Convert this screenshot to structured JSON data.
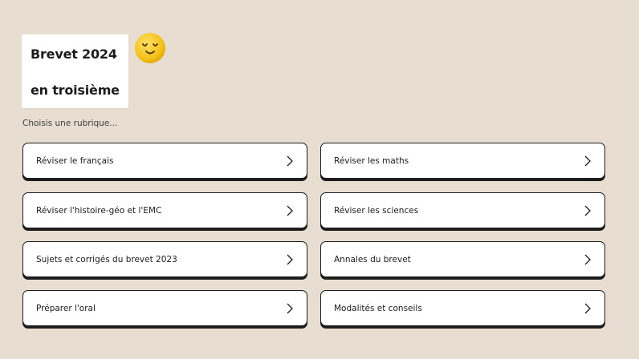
{
  "header": {
    "title_line1": "Brevet 2024",
    "title_line2": "en troisième",
    "subtitle": "Choisis une rubrique..."
  },
  "emoji": {
    "icon": "smiling-face-icon",
    "color": "#f5c21b"
  },
  "menu": {
    "items": [
      {
        "label": "Réviser le français"
      },
      {
        "label": "Réviser les maths"
      },
      {
        "label": "Réviser l'histoire-géo et l'EMC"
      },
      {
        "label": "Réviser les sciences"
      },
      {
        "label": "Sujets et corrigés du brevet 2023"
      },
      {
        "label": "Annales du brevet"
      },
      {
        "label": "Préparer l'oral"
      },
      {
        "label": "Modalités et conseils"
      }
    ],
    "chevron_icon": "chevron-right-icon"
  },
  "colors": {
    "background": "#e7ddd1",
    "card": "#ffffff",
    "border": "#1d1d1d"
  }
}
